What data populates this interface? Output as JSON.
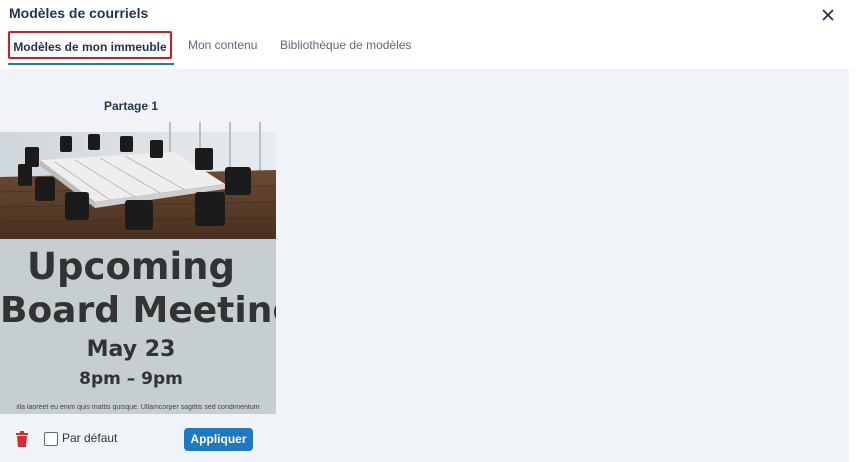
{
  "header": {
    "title": "Modèles de courriels",
    "close_icon": "close-icon"
  },
  "tabs": [
    {
      "label": "Modèles de mon immeuble",
      "active": true
    },
    {
      "label": "Mon contenu",
      "active": false
    },
    {
      "label": "Bibliothèque de modèles",
      "active": false
    }
  ],
  "colors": {
    "accent": "#1f78c1",
    "highlight_border": "#cc1f1f",
    "trash": "#d32f2f",
    "content_bg": "#f0f4f9"
  },
  "template_card": {
    "title": "Partage 1",
    "poster": {
      "line1": "Upcoming",
      "line2": "Board Meeting",
      "date": "May 23",
      "time": "8pm – 9pm",
      "lorem": "illa laoreet eu enim quis mattis quisque. Ullamcorper sagittis sed condimentum"
    },
    "default_label": "Par défaut",
    "default_checked": false,
    "apply_label": "Appliquer",
    "delete_icon": "trash-icon"
  }
}
